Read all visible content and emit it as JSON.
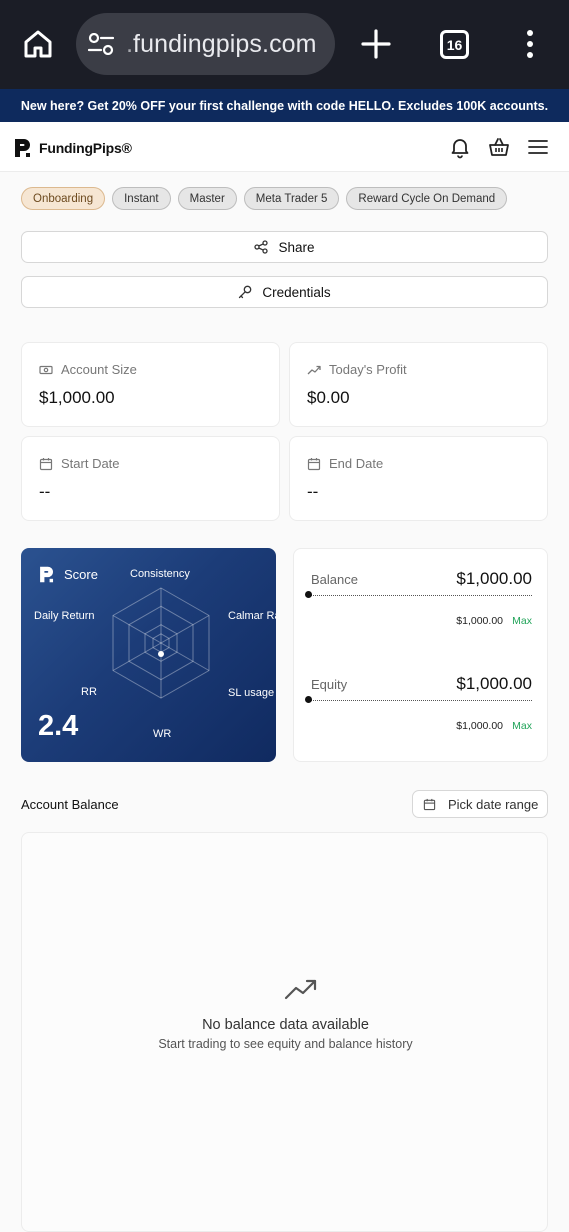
{
  "browser": {
    "url": ".fundingpips.com",
    "tab_count": "16"
  },
  "promo": {
    "text": "New here? Get 20% OFF your first challenge with code HELLO. Excludes 100K accounts."
  },
  "header": {
    "brand": "FundingPips®"
  },
  "tags": [
    "Onboarding",
    "Instant",
    "Master",
    "Meta Trader 5",
    "Reward Cycle On Demand"
  ],
  "actions": {
    "share_label": "Share",
    "credentials_label": "Credentials"
  },
  "stats": {
    "account_size": {
      "label": "Account Size",
      "value": "$1,000.00"
    },
    "todays_profit": {
      "label": "Today's Profit",
      "value": "$0.00"
    },
    "start_date": {
      "label": "Start Date",
      "value": "--"
    },
    "end_date": {
      "label": "End Date",
      "value": "--"
    }
  },
  "score": {
    "title": "Score",
    "value": "2.4",
    "axes": [
      "Consistency",
      "Calmar Ra",
      "SL usage",
      "WR",
      "RR",
      "Daily Return"
    ]
  },
  "balance": {
    "label": "Balance",
    "value": "$1,000.00",
    "max_value": "$1,000.00",
    "max_label": "Max"
  },
  "equity": {
    "label": "Equity",
    "value": "$1,000.00",
    "max_value": "$1,000.00",
    "max_label": "Max"
  },
  "account_balance": {
    "title": "Account Balance",
    "date_range_label": "Pick date range",
    "empty_title": "No balance data available",
    "empty_subtitle": "Start trading to see equity and balance history"
  },
  "colors": {
    "promo_bg": "#0e2a5d",
    "score_card_bg": "#1c3c78",
    "max_green": "#22a45a",
    "active_tag_bg": "#f6e6d3"
  }
}
